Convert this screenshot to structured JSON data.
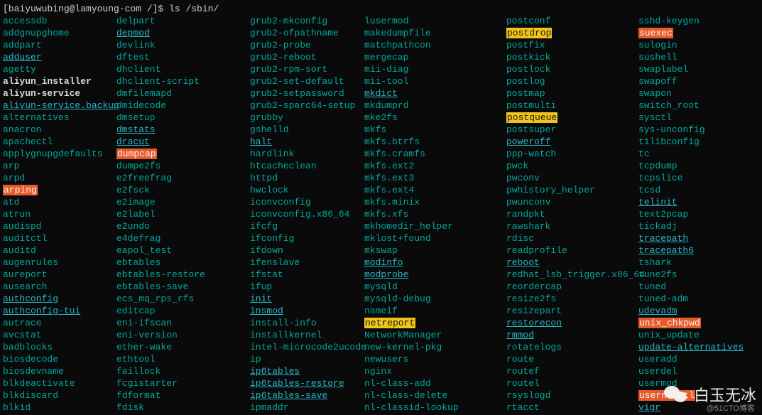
{
  "prompt": {
    "userhost": "[baiyuwubing@lamyoung-com /]$ ",
    "command": "ls /sbin/"
  },
  "columns": [
    [
      {
        "t": "accessdb",
        "c": "plain"
      },
      {
        "t": "addgnupghome",
        "c": "plain"
      },
      {
        "t": "addpart",
        "c": "plain"
      },
      {
        "t": "adduser",
        "c": "link"
      },
      {
        "t": "agetty",
        "c": "plain"
      },
      {
        "t": "aliyun_installer",
        "c": "bold"
      },
      {
        "t": "aliyun-service",
        "c": "bold"
      },
      {
        "t": "aliyun-service.backup",
        "c": "link"
      },
      {
        "t": "alternatives",
        "c": "plain"
      },
      {
        "t": "anacron",
        "c": "plain"
      },
      {
        "t": "apachectl",
        "c": "plain"
      },
      {
        "t": "applygnupgdefaults",
        "c": "plain"
      },
      {
        "t": "arp",
        "c": "plain"
      },
      {
        "t": "arpd",
        "c": "plain"
      },
      {
        "t": "arping",
        "c": "hl-orange"
      },
      {
        "t": "atd",
        "c": "plain"
      },
      {
        "t": "atrun",
        "c": "plain"
      },
      {
        "t": "audispd",
        "c": "plain"
      },
      {
        "t": "auditctl",
        "c": "plain"
      },
      {
        "t": "auditd",
        "c": "plain"
      },
      {
        "t": "augenrules",
        "c": "plain"
      },
      {
        "t": "aureport",
        "c": "plain"
      },
      {
        "t": "ausearch",
        "c": "plain"
      },
      {
        "t": "authconfig",
        "c": "link"
      },
      {
        "t": "authconfig-tui",
        "c": "link"
      },
      {
        "t": "autrace",
        "c": "plain"
      },
      {
        "t": "avcstat",
        "c": "plain"
      },
      {
        "t": "badblocks",
        "c": "plain"
      },
      {
        "t": "biosdecode",
        "c": "plain"
      },
      {
        "t": "biosdevname",
        "c": "plain"
      },
      {
        "t": "blkdeactivate",
        "c": "plain"
      },
      {
        "t": "blkdiscard",
        "c": "plain"
      },
      {
        "t": "blkid",
        "c": "plain"
      }
    ],
    [
      {
        "t": "delpart",
        "c": "plain"
      },
      {
        "t": "depmod",
        "c": "link"
      },
      {
        "t": "devlink",
        "c": "plain"
      },
      {
        "t": "dftest",
        "c": "plain"
      },
      {
        "t": "dhclient",
        "c": "plain"
      },
      {
        "t": "dhclient-script",
        "c": "plain"
      },
      {
        "t": "dmfilemapd",
        "c": "plain"
      },
      {
        "t": "dmidecode",
        "c": "plain"
      },
      {
        "t": "dmsetup",
        "c": "plain"
      },
      {
        "t": "dmstats",
        "c": "link"
      },
      {
        "t": "dracut",
        "c": "link"
      },
      {
        "t": "dumpcap",
        "c": "hl-orange"
      },
      {
        "t": "dumpe2fs",
        "c": "plain"
      },
      {
        "t": "e2freefrag",
        "c": "plain"
      },
      {
        "t": "e2fsck",
        "c": "plain"
      },
      {
        "t": "e2image",
        "c": "plain"
      },
      {
        "t": "e2label",
        "c": "plain"
      },
      {
        "t": "e2undo",
        "c": "plain"
      },
      {
        "t": "e4defrag",
        "c": "plain"
      },
      {
        "t": "eapol_test",
        "c": "plain"
      },
      {
        "t": "ebtables",
        "c": "plain"
      },
      {
        "t": "ebtables-restore",
        "c": "plain"
      },
      {
        "t": "ebtables-save",
        "c": "plain"
      },
      {
        "t": "ecs_mq_rps_rfs",
        "c": "plain"
      },
      {
        "t": "editcap",
        "c": "plain"
      },
      {
        "t": "eni-ifscan",
        "c": "plain"
      },
      {
        "t": "eni-version",
        "c": "plain"
      },
      {
        "t": "ether-wake",
        "c": "plain"
      },
      {
        "t": "ethtool",
        "c": "plain"
      },
      {
        "t": "faillock",
        "c": "plain"
      },
      {
        "t": "fcgistarter",
        "c": "plain"
      },
      {
        "t": "fdformat",
        "c": "plain"
      },
      {
        "t": "fdisk",
        "c": "plain"
      }
    ],
    [
      {
        "t": "grub2-mkconfig",
        "c": "plain"
      },
      {
        "t": "grub2-ofpathname",
        "c": "plain"
      },
      {
        "t": "grub2-probe",
        "c": "plain"
      },
      {
        "t": "grub2-reboot",
        "c": "plain"
      },
      {
        "t": "grub2-rpm-sort",
        "c": "plain"
      },
      {
        "t": "grub2-set-default",
        "c": "plain"
      },
      {
        "t": "grub2-setpassword",
        "c": "plain"
      },
      {
        "t": "grub2-sparc64-setup",
        "c": "plain"
      },
      {
        "t": "grubby",
        "c": "plain"
      },
      {
        "t": "gshelld",
        "c": "plain"
      },
      {
        "t": "halt",
        "c": "link"
      },
      {
        "t": "hardlink",
        "c": "plain"
      },
      {
        "t": "htcacheclean",
        "c": "plain"
      },
      {
        "t": "httpd",
        "c": "plain"
      },
      {
        "t": "hwclock",
        "c": "plain"
      },
      {
        "t": "iconvconfig",
        "c": "plain"
      },
      {
        "t": "iconvconfig.x86_64",
        "c": "plain"
      },
      {
        "t": "ifcfg",
        "c": "plain"
      },
      {
        "t": "ifconfig",
        "c": "plain"
      },
      {
        "t": "ifdown",
        "c": "plain"
      },
      {
        "t": "ifenslave",
        "c": "plain"
      },
      {
        "t": "ifstat",
        "c": "plain"
      },
      {
        "t": "ifup",
        "c": "plain"
      },
      {
        "t": "init",
        "c": "link"
      },
      {
        "t": "insmod",
        "c": "link"
      },
      {
        "t": "install-info",
        "c": "plain"
      },
      {
        "t": "installkernel",
        "c": "plain"
      },
      {
        "t": "intel-microcode2ucode",
        "c": "plain"
      },
      {
        "t": "ip",
        "c": "plain"
      },
      {
        "t": "ip6tables",
        "c": "link"
      },
      {
        "t": "ip6tables-restore",
        "c": "link"
      },
      {
        "t": "ip6tables-save",
        "c": "link"
      },
      {
        "t": "ipmaddr",
        "c": "plain"
      }
    ],
    [
      {
        "t": "lusermod",
        "c": "plain"
      },
      {
        "t": "makedumpfile",
        "c": "plain"
      },
      {
        "t": "matchpathcon",
        "c": "plain"
      },
      {
        "t": "mergecap",
        "c": "plain"
      },
      {
        "t": "mii-diag",
        "c": "plain"
      },
      {
        "t": "mii-tool",
        "c": "plain"
      },
      {
        "t": "mkdict",
        "c": "link"
      },
      {
        "t": "mkdumprd",
        "c": "plain"
      },
      {
        "t": "mke2fs",
        "c": "plain"
      },
      {
        "t": "mkfs",
        "c": "plain"
      },
      {
        "t": "mkfs.btrfs",
        "c": "plain"
      },
      {
        "t": "mkfs.cramfs",
        "c": "plain"
      },
      {
        "t": "mkfs.ext2",
        "c": "plain"
      },
      {
        "t": "mkfs.ext3",
        "c": "plain"
      },
      {
        "t": "mkfs.ext4",
        "c": "plain"
      },
      {
        "t": "mkfs.minix",
        "c": "plain"
      },
      {
        "t": "mkfs.xfs",
        "c": "plain"
      },
      {
        "t": "mkhomedir_helper",
        "c": "plain"
      },
      {
        "t": "mklost+found",
        "c": "plain"
      },
      {
        "t": "mkswap",
        "c": "plain"
      },
      {
        "t": "modinfo",
        "c": "link"
      },
      {
        "t": "modprobe",
        "c": "link"
      },
      {
        "t": "mysqld",
        "c": "plain"
      },
      {
        "t": "mysqld-debug",
        "c": "plain"
      },
      {
        "t": "nameif",
        "c": "plain"
      },
      {
        "t": "netreport",
        "c": "hl-yellow"
      },
      {
        "t": "NetworkManager",
        "c": "plain"
      },
      {
        "t": "new-kernel-pkg",
        "c": "plain"
      },
      {
        "t": "newusers",
        "c": "plain"
      },
      {
        "t": "nginx",
        "c": "plain"
      },
      {
        "t": "nl-class-add",
        "c": "plain"
      },
      {
        "t": "nl-class-delete",
        "c": "plain"
      },
      {
        "t": "nl-classid-lookup",
        "c": "plain"
      }
    ],
    [
      {
        "t": "postconf",
        "c": "plain"
      },
      {
        "t": "postdrop",
        "c": "hl-yellow"
      },
      {
        "t": "postfix",
        "c": "plain"
      },
      {
        "t": "postkick",
        "c": "plain"
      },
      {
        "t": "postlock",
        "c": "plain"
      },
      {
        "t": "postlog",
        "c": "plain"
      },
      {
        "t": "postmap",
        "c": "plain"
      },
      {
        "t": "postmulti",
        "c": "plain"
      },
      {
        "t": "postqueue",
        "c": "hl-yellow"
      },
      {
        "t": "postsuper",
        "c": "plain"
      },
      {
        "t": "poweroff",
        "c": "link"
      },
      {
        "t": "ppp-watch",
        "c": "plain"
      },
      {
        "t": "pwck",
        "c": "plain"
      },
      {
        "t": "pwconv",
        "c": "plain"
      },
      {
        "t": "pwhistory_helper",
        "c": "plain"
      },
      {
        "t": "pwunconv",
        "c": "plain"
      },
      {
        "t": "randpkt",
        "c": "plain"
      },
      {
        "t": "rawshark",
        "c": "plain"
      },
      {
        "t": "rdisc",
        "c": "plain"
      },
      {
        "t": "readprofile",
        "c": "plain"
      },
      {
        "t": "reboot",
        "c": "link"
      },
      {
        "t": "redhat_lsb_trigger.x86_64",
        "c": "plain"
      },
      {
        "t": "reordercap",
        "c": "plain"
      },
      {
        "t": "resize2fs",
        "c": "plain"
      },
      {
        "t": "resizepart",
        "c": "plain"
      },
      {
        "t": "restorecon",
        "c": "link"
      },
      {
        "t": "rmmod",
        "c": "link"
      },
      {
        "t": "rotatelogs",
        "c": "plain"
      },
      {
        "t": "route",
        "c": "plain"
      },
      {
        "t": "routef",
        "c": "plain"
      },
      {
        "t": "routel",
        "c": "plain"
      },
      {
        "t": "rsyslogd",
        "c": "plain"
      },
      {
        "t": "rtacct",
        "c": "plain"
      }
    ],
    [
      {
        "t": "sshd-keygen",
        "c": "plain"
      },
      {
        "t": "suexec",
        "c": "hl-orange"
      },
      {
        "t": "sulogin",
        "c": "plain"
      },
      {
        "t": "sushell",
        "c": "plain"
      },
      {
        "t": "swaplabel",
        "c": "plain"
      },
      {
        "t": "swapoff",
        "c": "plain"
      },
      {
        "t": "swapon",
        "c": "plain"
      },
      {
        "t": "switch_root",
        "c": "plain"
      },
      {
        "t": "sysctl",
        "c": "plain"
      },
      {
        "t": "sys-unconfig",
        "c": "plain"
      },
      {
        "t": "t1libconfig",
        "c": "plain"
      },
      {
        "t": "tc",
        "c": "plain"
      },
      {
        "t": "tcpdump",
        "c": "plain"
      },
      {
        "t": "tcpslice",
        "c": "plain"
      },
      {
        "t": "tcsd",
        "c": "plain"
      },
      {
        "t": "telinit",
        "c": "link"
      },
      {
        "t": "text2pcap",
        "c": "plain"
      },
      {
        "t": "tickadj",
        "c": "plain"
      },
      {
        "t": "tracepath",
        "c": "link"
      },
      {
        "t": "tracepath6",
        "c": "link"
      },
      {
        "t": "tshark",
        "c": "plain"
      },
      {
        "t": "tune2fs",
        "c": "plain"
      },
      {
        "t": "tuned",
        "c": "plain"
      },
      {
        "t": "tuned-adm",
        "c": "plain"
      },
      {
        "t": "udevadm",
        "c": "link"
      },
      {
        "t": "unix_chkpwd",
        "c": "hl-orange"
      },
      {
        "t": "unix_update",
        "c": "plain"
      },
      {
        "t": "update-alternatives",
        "c": "link"
      },
      {
        "t": "useradd",
        "c": "plain"
      },
      {
        "t": "userdel",
        "c": "plain"
      },
      {
        "t": "usermod",
        "c": "plain"
      },
      {
        "t": "usernetctl",
        "c": "hl-orange"
      },
      {
        "t": "vigr",
        "c": "link"
      }
    ]
  ],
  "watermark": {
    "text": "白玉无冰",
    "sub": "@51CTO博客"
  }
}
